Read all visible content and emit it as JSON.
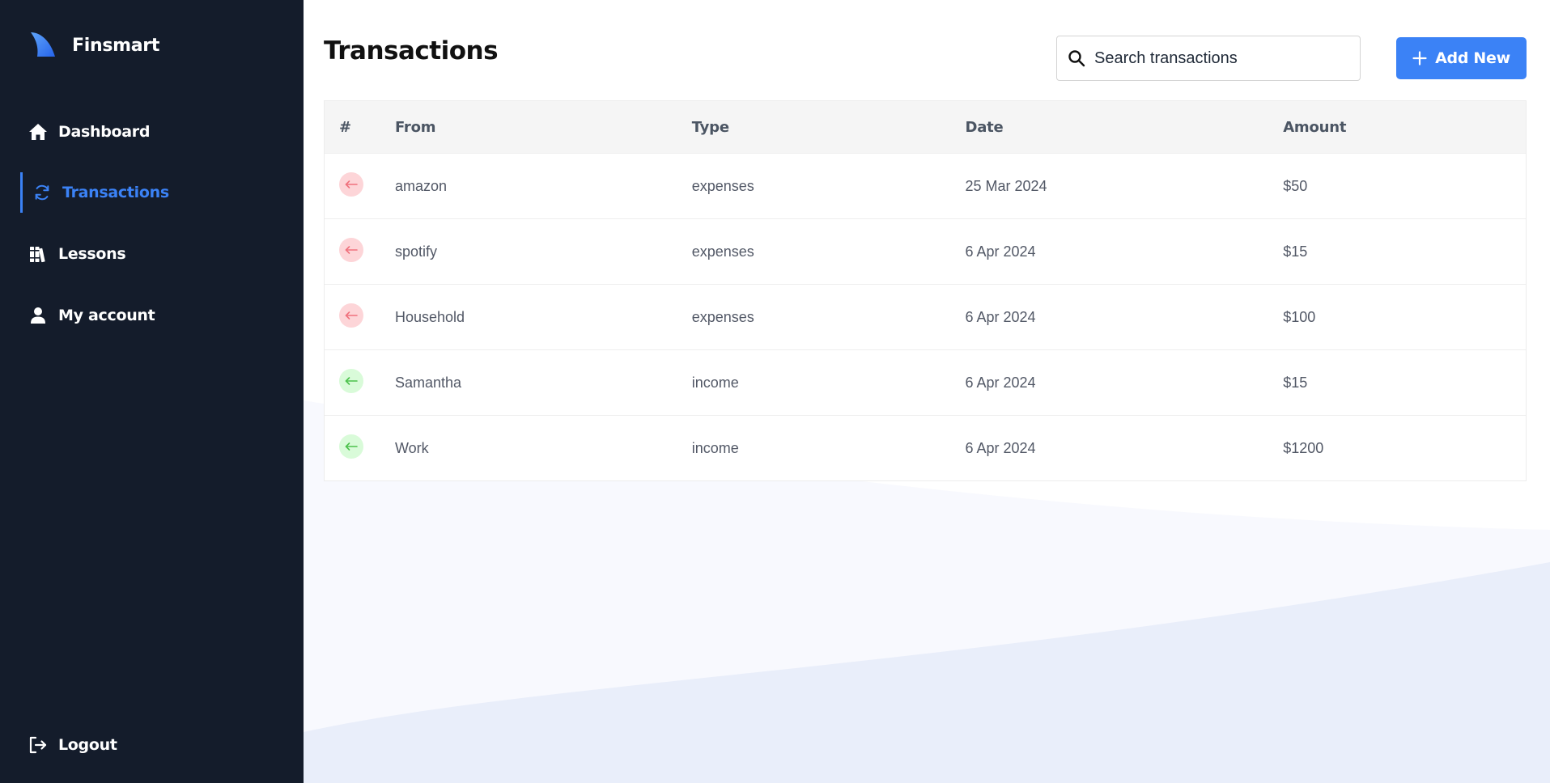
{
  "brand": {
    "name": "Finsmart"
  },
  "sidebar": {
    "items": [
      {
        "label": "Dashboard",
        "icon": "home-icon",
        "active": false
      },
      {
        "label": "Transactions",
        "icon": "refresh-icon",
        "active": true
      },
      {
        "label": "Lessons",
        "icon": "books-icon",
        "active": false
      },
      {
        "label": "My account",
        "icon": "user-icon",
        "active": false
      }
    ],
    "logout": {
      "label": "Logout",
      "icon": "logout-icon"
    }
  },
  "header": {
    "title": "Transactions",
    "search": {
      "placeholder": "Search transactions",
      "value": ""
    },
    "add_button": "Add New"
  },
  "table": {
    "columns": [
      "#",
      "From",
      "Type",
      "Date",
      "Amount"
    ],
    "rows": [
      {
        "direction": "expense",
        "from": "amazon",
        "type": "expenses",
        "date": "25 Mar 2024",
        "amount": "$50"
      },
      {
        "direction": "expense",
        "from": "spotify",
        "type": "expenses",
        "date": "6 Apr 2024",
        "amount": "$15"
      },
      {
        "direction": "expense",
        "from": "Household",
        "type": "expenses",
        "date": "6 Apr 2024",
        "amount": "$100"
      },
      {
        "direction": "income",
        "from": "Samantha",
        "type": "income",
        "date": "6 Apr 2024",
        "amount": "$15"
      },
      {
        "direction": "income",
        "from": "Work",
        "type": "income",
        "date": "6 Apr 2024",
        "amount": "$1200"
      }
    ]
  },
  "colors": {
    "sidebar_bg": "#141c2b",
    "accent": "#3b82f6",
    "expense_badge": "#fdd5d8",
    "expense_arrow": "#f0717d",
    "income_badge": "#d9fbd9",
    "income_arrow": "#4cc24c"
  }
}
